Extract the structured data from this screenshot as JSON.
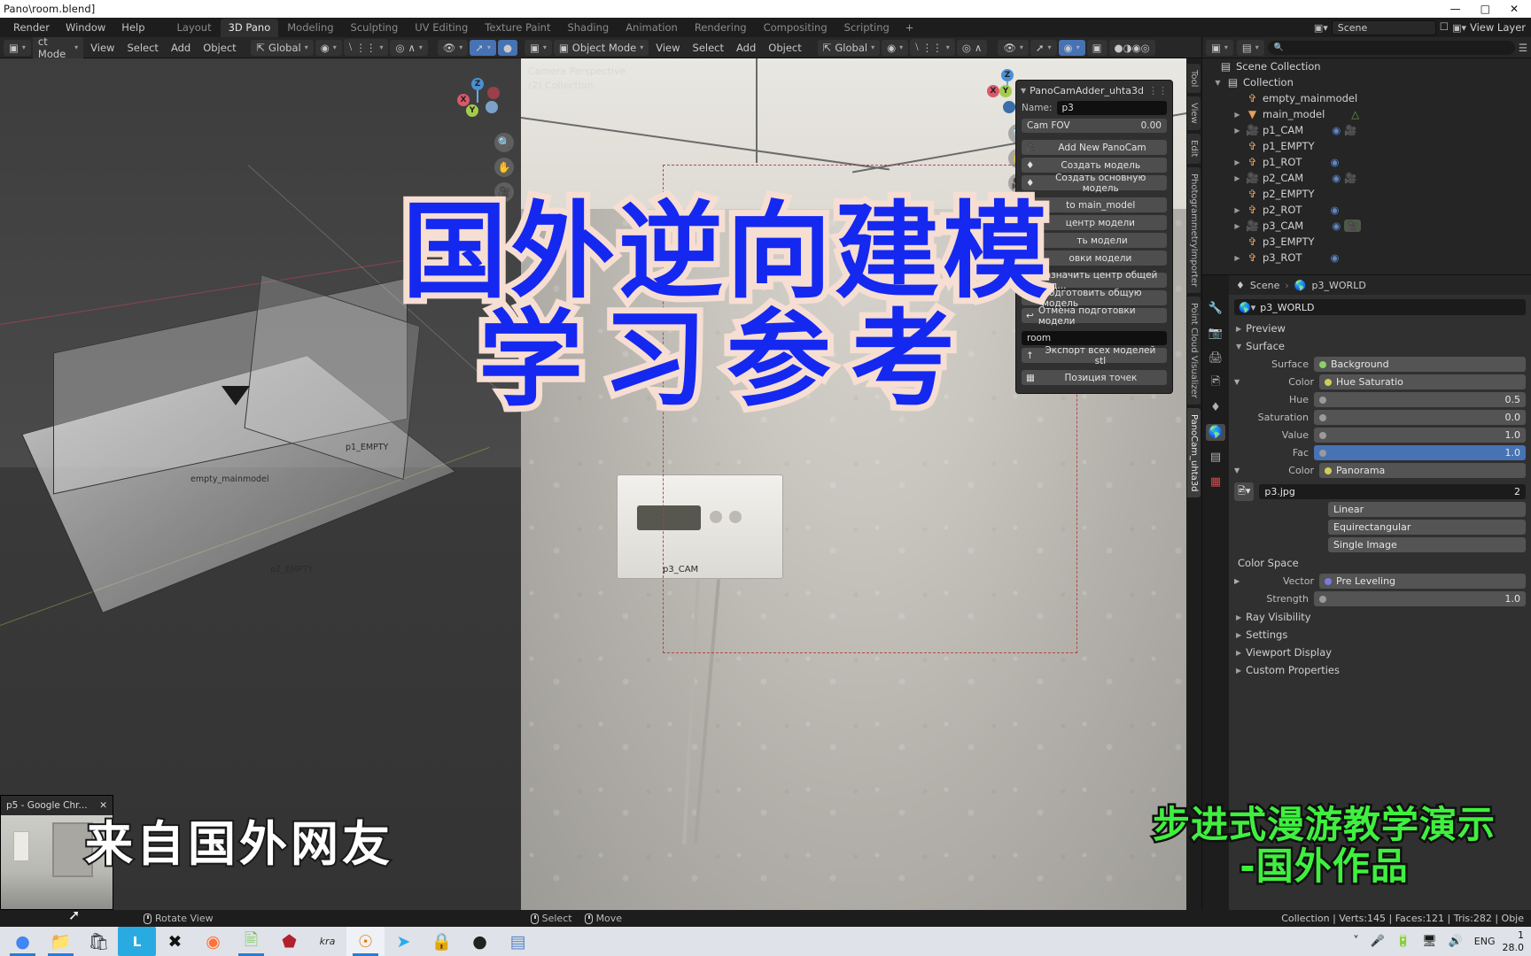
{
  "titlebar": {
    "title": "Pano\\room.blend]",
    "minimize": "—",
    "maximize": "□",
    "close": "✕"
  },
  "topbar": {
    "menus": [
      "Render",
      "Window",
      "Help"
    ],
    "workspaces": [
      {
        "label": "Layout",
        "active": false
      },
      {
        "label": "3D Pano",
        "active": true
      },
      {
        "label": "Modeling",
        "active": false
      },
      {
        "label": "Sculpting",
        "active": false
      },
      {
        "label": "UV Editing",
        "active": false
      },
      {
        "label": "Texture Paint",
        "active": false
      },
      {
        "label": "Shading",
        "active": false
      },
      {
        "label": "Animation",
        "active": false
      },
      {
        "label": "Rendering",
        "active": false
      },
      {
        "label": "Compositing",
        "active": false
      },
      {
        "label": "Scripting",
        "active": false
      }
    ],
    "add_workspace": "+",
    "scene_name": "Scene",
    "view_layer_name": "View Layer"
  },
  "viewport1": {
    "mode": "ct Mode",
    "menus": [
      "View",
      "Select",
      "Add",
      "Object"
    ],
    "transform_orientation": "Global",
    "labels": {
      "empty_mainmodel": "empty_mainmodel",
      "p1_empty": "p1_EMPTY",
      "p2_empty": "p2_EMPTY"
    },
    "gizmo_axes": [
      "Z",
      "Y",
      "X"
    ]
  },
  "viewport2": {
    "mode": "Object Mode",
    "menus": [
      "View",
      "Select",
      "Add",
      "Object"
    ],
    "transform_orientation": "Global",
    "overlay_line1": "Camera Perspective",
    "overlay_line2": "(2) Collection",
    "cam_label": "p3_CAM",
    "gizmo_axes": [
      "Z",
      "Y",
      "X"
    ]
  },
  "panocam": {
    "panel_title": "PanoCamAdder_uhta3d",
    "name_label": "Name:",
    "name_value": "p3",
    "fov_label": "Cam FOV",
    "fov_value": "0.00",
    "buttons": [
      {
        "label": "Add New PanoCam",
        "icon": "camera-icon"
      },
      {
        "label": "Создать модель",
        "icon": "mesh-icon"
      },
      {
        "label": "Создать основную модель",
        "icon": "mesh-icon"
      },
      {
        "label": "to main_model",
        "icon": "link-icon"
      },
      {
        "label": "центр модели",
        "icon": "center-icon"
      },
      {
        "label": "ть модели",
        "icon": "tool-icon"
      },
      {
        "label": "овки модели",
        "icon": "undo-icon"
      },
      {
        "label": "Назначить центр общей мод...",
        "icon": "center-icon"
      },
      {
        "label": "Подготовить общую модель",
        "icon": "tool-icon"
      },
      {
        "label": "Отмена подготовки модели",
        "icon": "undo-icon"
      }
    ],
    "export_field": "room",
    "export_button": "Экспорт всех моделей stl",
    "points_button": "Позиция точек"
  },
  "vtabs_viewport2": [
    {
      "label": "Tool",
      "active": false
    },
    {
      "label": "View",
      "active": false
    },
    {
      "label": "Edit",
      "active": false
    },
    {
      "label": "PhotogrammetryImporter",
      "active": false
    },
    {
      "label": "Point Cloud Visualizer",
      "active": false
    },
    {
      "label": "PanoCam_uhta3d",
      "active": true
    }
  ],
  "outliner": {
    "search_placeholder": "",
    "scene_collection": "Scene Collection",
    "collection": "Collection",
    "items": [
      {
        "name": "empty_mainmodel",
        "icon": "empty-axis-icon",
        "indent": 2,
        "disclose": false,
        "badges": []
      },
      {
        "name": "main_model",
        "icon": "mesh-data-icon",
        "indent": 2,
        "disclose": true,
        "badges": [
          "mesh-green"
        ]
      },
      {
        "name": "p1_CAM",
        "icon": "camera-icon",
        "indent": 2,
        "disclose": true,
        "badges": [
          "anim-blue",
          "camera-green"
        ]
      },
      {
        "name": "p1_EMPTY",
        "icon": "empty-axis-icon",
        "indent": 2,
        "disclose": false,
        "badges": []
      },
      {
        "name": "p1_ROT",
        "icon": "empty-axis-icon",
        "indent": 2,
        "disclose": true,
        "badges": [
          "anim-blue"
        ]
      },
      {
        "name": "p2_CAM",
        "icon": "camera-icon",
        "indent": 2,
        "disclose": true,
        "badges": [
          "anim-blue",
          "camera-green"
        ]
      },
      {
        "name": "p2_EMPTY",
        "icon": "empty-axis-icon",
        "indent": 2,
        "disclose": false,
        "badges": []
      },
      {
        "name": "p2_ROT",
        "icon": "empty-axis-icon",
        "indent": 2,
        "disclose": true,
        "badges": [
          "anim-blue"
        ]
      },
      {
        "name": "p3_CAM",
        "icon": "camera-icon",
        "indent": 2,
        "disclose": true,
        "badges": [
          "anim-blue",
          "camera-green-sel"
        ]
      },
      {
        "name": "p3_EMPTY",
        "icon": "empty-axis-icon",
        "indent": 2,
        "disclose": false,
        "badges": []
      },
      {
        "name": "p3_ROT",
        "icon": "empty-axis-icon",
        "indent": 2,
        "disclose": true,
        "badges": [
          "anim-blue"
        ]
      }
    ]
  },
  "properties": {
    "breadcrumb_scene": "Scene",
    "breadcrumb_world": "p3_WORLD",
    "id_name": "p3_WORLD",
    "sections": {
      "preview": "Preview",
      "surface": "Surface",
      "settings": "Settings",
      "viewport_display": "Viewport Display",
      "custom_properties": "Custom Properties",
      "ray_visibility": "Ray Visibility"
    },
    "rows": [
      {
        "label": "Surface",
        "value": "Background",
        "dotcolor": "#8fce6a",
        "style": "enum"
      },
      {
        "label": "Color",
        "value": "Hue Saturatio",
        "dotcolor": "#cfce5a",
        "style": "enum",
        "tri": true
      },
      {
        "label": "Hue",
        "value": "0.5",
        "dotcolor": "#9a9a9a",
        "style": "slider"
      },
      {
        "label": "Saturation",
        "value": "0.0",
        "dotcolor": "#9a9a9a",
        "style": "slider"
      },
      {
        "label": "Value",
        "value": "1.0",
        "dotcolor": "#9a9a9a",
        "style": "slider"
      },
      {
        "label": "Fac",
        "value": "1.0",
        "dotcolor": "#9a9a9a",
        "style": "fac"
      },
      {
        "label": "Color",
        "value": "Panorama",
        "dotcolor": "#cfce5a",
        "style": "enum",
        "tri": true
      }
    ],
    "image_name": "p3.jpg",
    "image_users": "2",
    "image_opts": [
      "Linear",
      "Equirectangular",
      "Single Image"
    ],
    "color_space_label": "Color Space",
    "vector_label": "Vector",
    "vector_value": "Pre Leveling",
    "strength_label": "Strength",
    "strength_value": "1.0"
  },
  "statusbar": {
    "items": [
      {
        "icon": "mouse-icon",
        "label": "Rotate View"
      },
      {
        "icon": "mouse-icon",
        "label": "Select"
      },
      {
        "icon": "mouse-icon",
        "label": "Move"
      }
    ],
    "stats": "Collection | Verts:145 | Faces:121 | Tris:282 | Obje"
  },
  "chrome_window": {
    "title": "p5 - Google Chr...",
    "close": "✕"
  },
  "taskbar": {
    "apps": [
      {
        "name": "chrome-icon",
        "glyph": "●",
        "color": "#4285F4",
        "running": true,
        "active": false
      },
      {
        "name": "file-explorer-icon",
        "glyph": "📁",
        "color": "#f8c050",
        "running": true,
        "active": false
      },
      {
        "name": "microsoft-store-icon",
        "glyph": "🛍",
        "color": "#333",
        "running": false,
        "active": false
      },
      {
        "name": "lightshot-icon",
        "glyph": "L",
        "color": "#29ABE2",
        "running": false,
        "active": false
      },
      {
        "name": "xbox-icon",
        "glyph": "✕",
        "color": "#111",
        "running": false,
        "active": false
      },
      {
        "name": "firefox-icon",
        "glyph": "◉",
        "color": "#ff7139",
        "running": false,
        "active": false
      },
      {
        "name": "notepad-icon",
        "glyph": "📄",
        "color": "#6fbf4f",
        "running": true,
        "active": false
      },
      {
        "name": "hwp-icon",
        "glyph": "⬟",
        "color": "#b41f2e",
        "running": false,
        "active": false
      },
      {
        "name": "krita-icon",
        "glyph": "kra",
        "color": "#2b2b2b",
        "running": false,
        "active": false
      },
      {
        "name": "blender-icon",
        "glyph": "⊙",
        "color": "#ea7600",
        "running": true,
        "active": true
      },
      {
        "name": "telegram-icon",
        "glyph": "➤",
        "color": "#2aabee",
        "running": false,
        "active": false
      },
      {
        "name": "unlocker-icon",
        "glyph": "🔒",
        "color": "#3a7fc4",
        "running": false,
        "active": false
      },
      {
        "name": "obs-icon",
        "glyph": "●",
        "color": "#222",
        "running": false,
        "active": false
      },
      {
        "name": "word-icon",
        "glyph": "▤",
        "color": "#5b87c7",
        "running": false,
        "active": false
      }
    ],
    "tray": [
      "chevron-up-icon",
      "microphone-icon",
      "battery-icon",
      "network-icon",
      "volume-icon"
    ],
    "language": "ENG",
    "clock_time": "1",
    "clock_date": "28.0"
  },
  "overlays": {
    "main_line1": "国外逆向建模",
    "main_line2": "学习参考",
    "bottom_left": "来自国外网友",
    "bottom_right_line1": "步进式漫游教学演示",
    "bottom_right_line2": "-国外作品"
  },
  "colors": {
    "accent_blue": "#4772b3",
    "overlay_blue": "#1528f0",
    "overlay_cream": "#f6ded2",
    "overlay_green": "#3ff03f",
    "outliner_orange": "#e5a05a"
  }
}
